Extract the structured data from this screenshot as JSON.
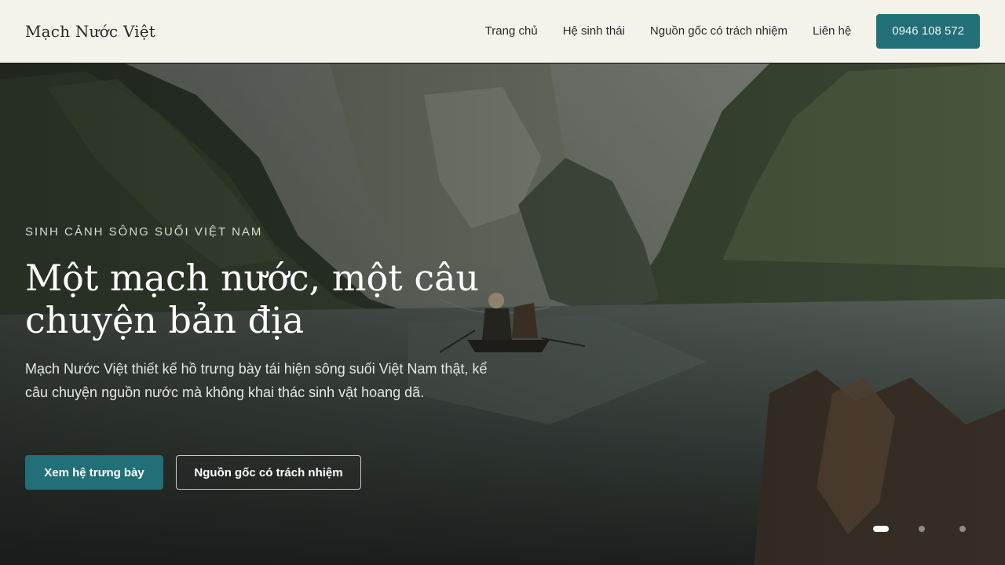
{
  "header": {
    "brand": "Mạch Nước Việt",
    "nav": [
      {
        "label": "Trang chủ"
      },
      {
        "label": "Hệ sinh thái"
      },
      {
        "label": "Nguồn gốc có trách nhiệm"
      },
      {
        "label": "Liên hệ"
      }
    ],
    "phone": "0946 108 572"
  },
  "hero": {
    "eyebrow": "SINH CẢNH SÔNG SUỐI VIỆT NAM",
    "title": "Một mạch nước, một câu chuyện bản địa",
    "description": "Mạch Nước Việt thiết kế hồ trưng bày tái hiện sông suối Việt Nam thật, kể câu chuyện nguồn nước mà không khai thác sinh vật hoang dã.",
    "primary_cta": "Xem hệ trưng bày",
    "secondary_cta": "Nguồn gốc có trách nhiệm",
    "slides": {
      "count": 3,
      "active": 1
    }
  },
  "colors": {
    "accent": "#236f78",
    "header_bg": "#f5f2ec",
    "text_dark": "#2a2a2a"
  }
}
